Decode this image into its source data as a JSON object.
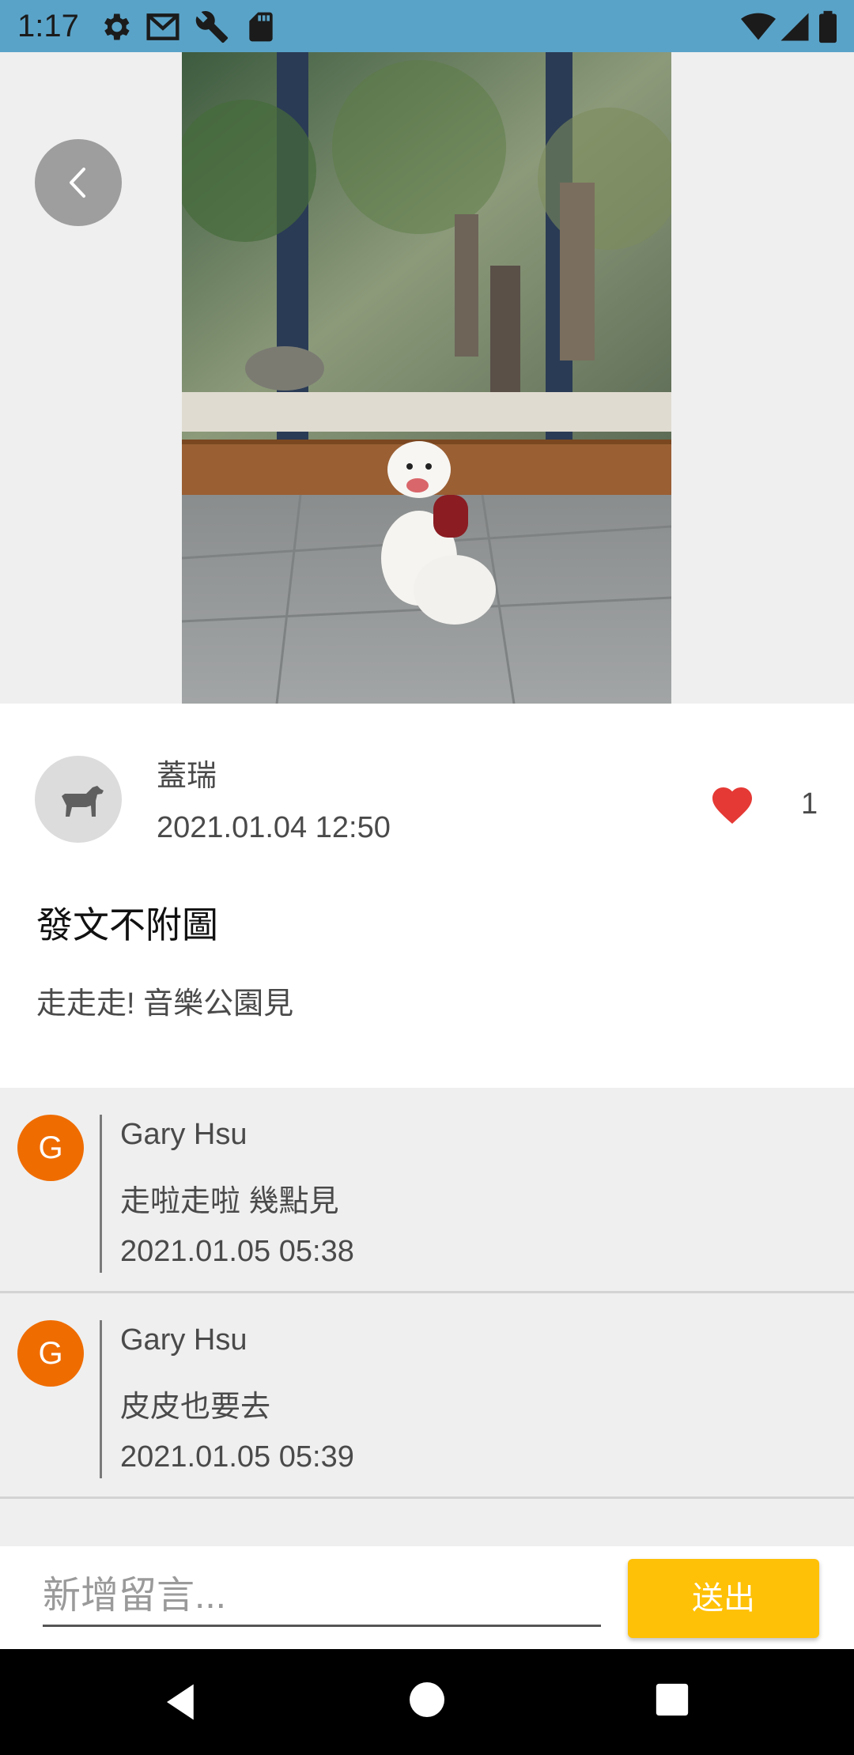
{
  "status_bar": {
    "time": "1:17",
    "left_icons": [
      "gear-icon",
      "gmail-icon",
      "wrench-icon",
      "sd-card-icon"
    ],
    "right_icons": [
      "wifi-icon",
      "cellular-signal-icon",
      "battery-icon"
    ]
  },
  "post": {
    "author": "蓋瑞",
    "date": "2021.01.04 12:50",
    "like_count": "1",
    "title": "發文不附圖",
    "body": "走走走! 音樂公園見"
  },
  "comments": [
    {
      "initial": "G",
      "name": "Gary Hsu",
      "text": "走啦走啦 幾點見",
      "date": "2021.01.05 05:38"
    },
    {
      "initial": "G",
      "name": "Gary Hsu",
      "text": "皮皮也要去",
      "date": "2021.01.05 05:39"
    }
  ],
  "comment_input": {
    "placeholder": "新增留言..."
  },
  "send_button": {
    "label": "送出"
  },
  "colors": {
    "status_bar": "#5aa3c8",
    "accent": "#ffc107",
    "heart": "#e53935",
    "comment_avatar": "#ef6c00"
  }
}
